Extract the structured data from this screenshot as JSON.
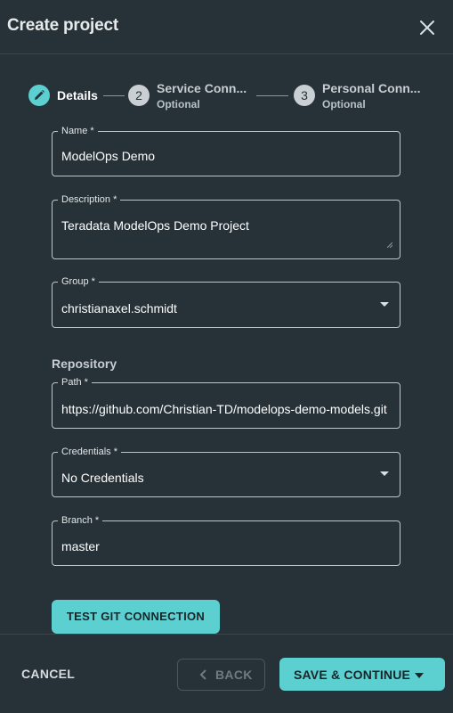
{
  "dialog": {
    "title": "Create project"
  },
  "stepper": {
    "steps": [
      {
        "number": "",
        "label": "Details",
        "sublabel": ""
      },
      {
        "number": "2",
        "label": "Service Conn...",
        "sublabel": "Optional"
      },
      {
        "number": "3",
        "label": "Personal Conn...",
        "sublabel": "Optional"
      }
    ]
  },
  "form": {
    "name": {
      "label": "Name *",
      "value": "ModelOps Demo"
    },
    "description": {
      "label": "Description *",
      "value": "Teradata ModelOps Demo Project"
    },
    "group": {
      "label": "Group *",
      "value": "christianaxel.schmidt"
    },
    "repository_heading": "Repository",
    "path": {
      "label": "Path *",
      "value": "https://github.com/Christian-TD/modelops-demo-models.git"
    },
    "credentials": {
      "label": "Credentials *",
      "value": "No Credentials"
    },
    "branch": {
      "label": "Branch *",
      "value": "master"
    },
    "test_button": "TEST GIT CONNECTION"
  },
  "footer": {
    "cancel": "CANCEL",
    "back": "BACK",
    "save": "SAVE & CONTINUE"
  },
  "colors": {
    "background": "#263238",
    "accent": "#5ccfd0"
  }
}
